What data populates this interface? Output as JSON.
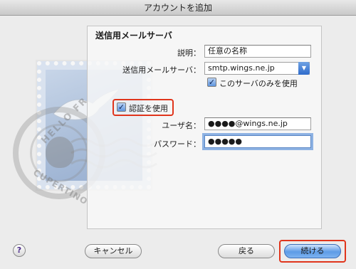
{
  "window": {
    "title": "アカウントを追加"
  },
  "section": {
    "title": "送信用メールサーバ"
  },
  "form": {
    "description_label": "説明：",
    "description_value": "任意の名称",
    "server_label": "送信用メールサーバ：",
    "server_value": "smtp.wings.ne.jp",
    "only_this_server_label": "このサーバのみを使用",
    "use_auth_label": "認証を使用",
    "username_label": "ユーザ名：",
    "username_value": "●●●●@wings.ne.jp",
    "password_label": "パスワード：",
    "password_value": "●●●●●"
  },
  "buttons": {
    "help": "?",
    "cancel": "キャンセル",
    "back": "戻る",
    "continue": "続ける"
  },
  "stamp": {
    "postmark_top": "HELLO FR",
    "postmark_bottom": "CUPERTINO"
  },
  "colors": {
    "highlight": "#e0351c",
    "accent": "#3d6fb8"
  }
}
